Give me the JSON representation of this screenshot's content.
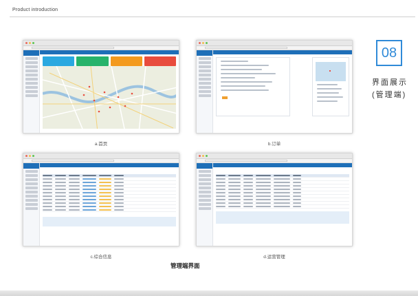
{
  "header": {
    "title": "Product introduction"
  },
  "section": {
    "number": "08",
    "title_line1": "界面展示",
    "title_line2": "(管理端)"
  },
  "screens": [
    {
      "caption": "a.首页"
    },
    {
      "caption": "b.订单"
    },
    {
      "caption": "c.综合信息"
    },
    {
      "caption": "d.运营管理"
    }
  ],
  "footer": {
    "label": "管理端界面"
  },
  "colors": {
    "accent": "#2f8ad8",
    "card_blue": "#2aa8e0",
    "card_green": "#27b36b",
    "card_orange": "#f39a1e",
    "card_red": "#e84c3d"
  }
}
